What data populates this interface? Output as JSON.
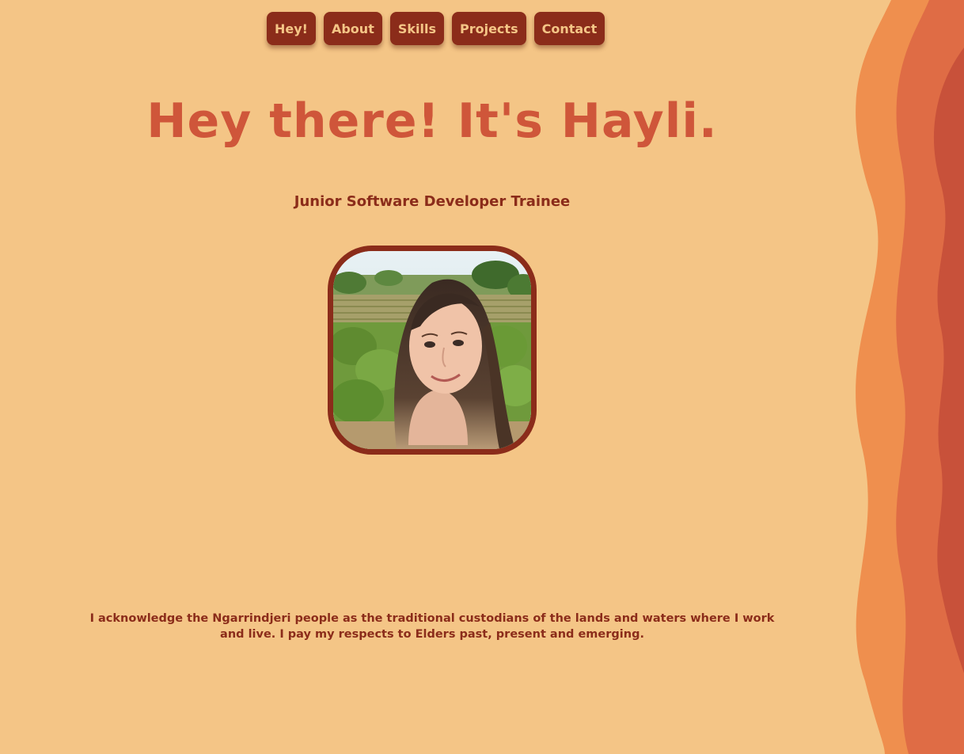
{
  "nav": {
    "items": [
      {
        "label": "Hey!"
      },
      {
        "label": "About"
      },
      {
        "label": "Skills"
      },
      {
        "label": "Projects"
      },
      {
        "label": "Contact"
      }
    ]
  },
  "hero": {
    "headline": "Hey there! It's Hayli.",
    "subtitle": "Junior Software Developer Trainee"
  },
  "footer": {
    "acknowledgement": "I acknowledge the Ngarrindjeri people as the traditional custodians of the lands and waters where I work and live. I pay my respects to Elders past, present and emerging."
  },
  "colors": {
    "background": "#f4c586",
    "nav_button": "#8b2c1a",
    "nav_text": "#f4c586",
    "headline": "#cf563a",
    "body_text": "#8b2c1a",
    "wave_light": "#ef8f4e",
    "wave_mid": "#df6c45",
    "wave_dark": "#c8513a"
  }
}
